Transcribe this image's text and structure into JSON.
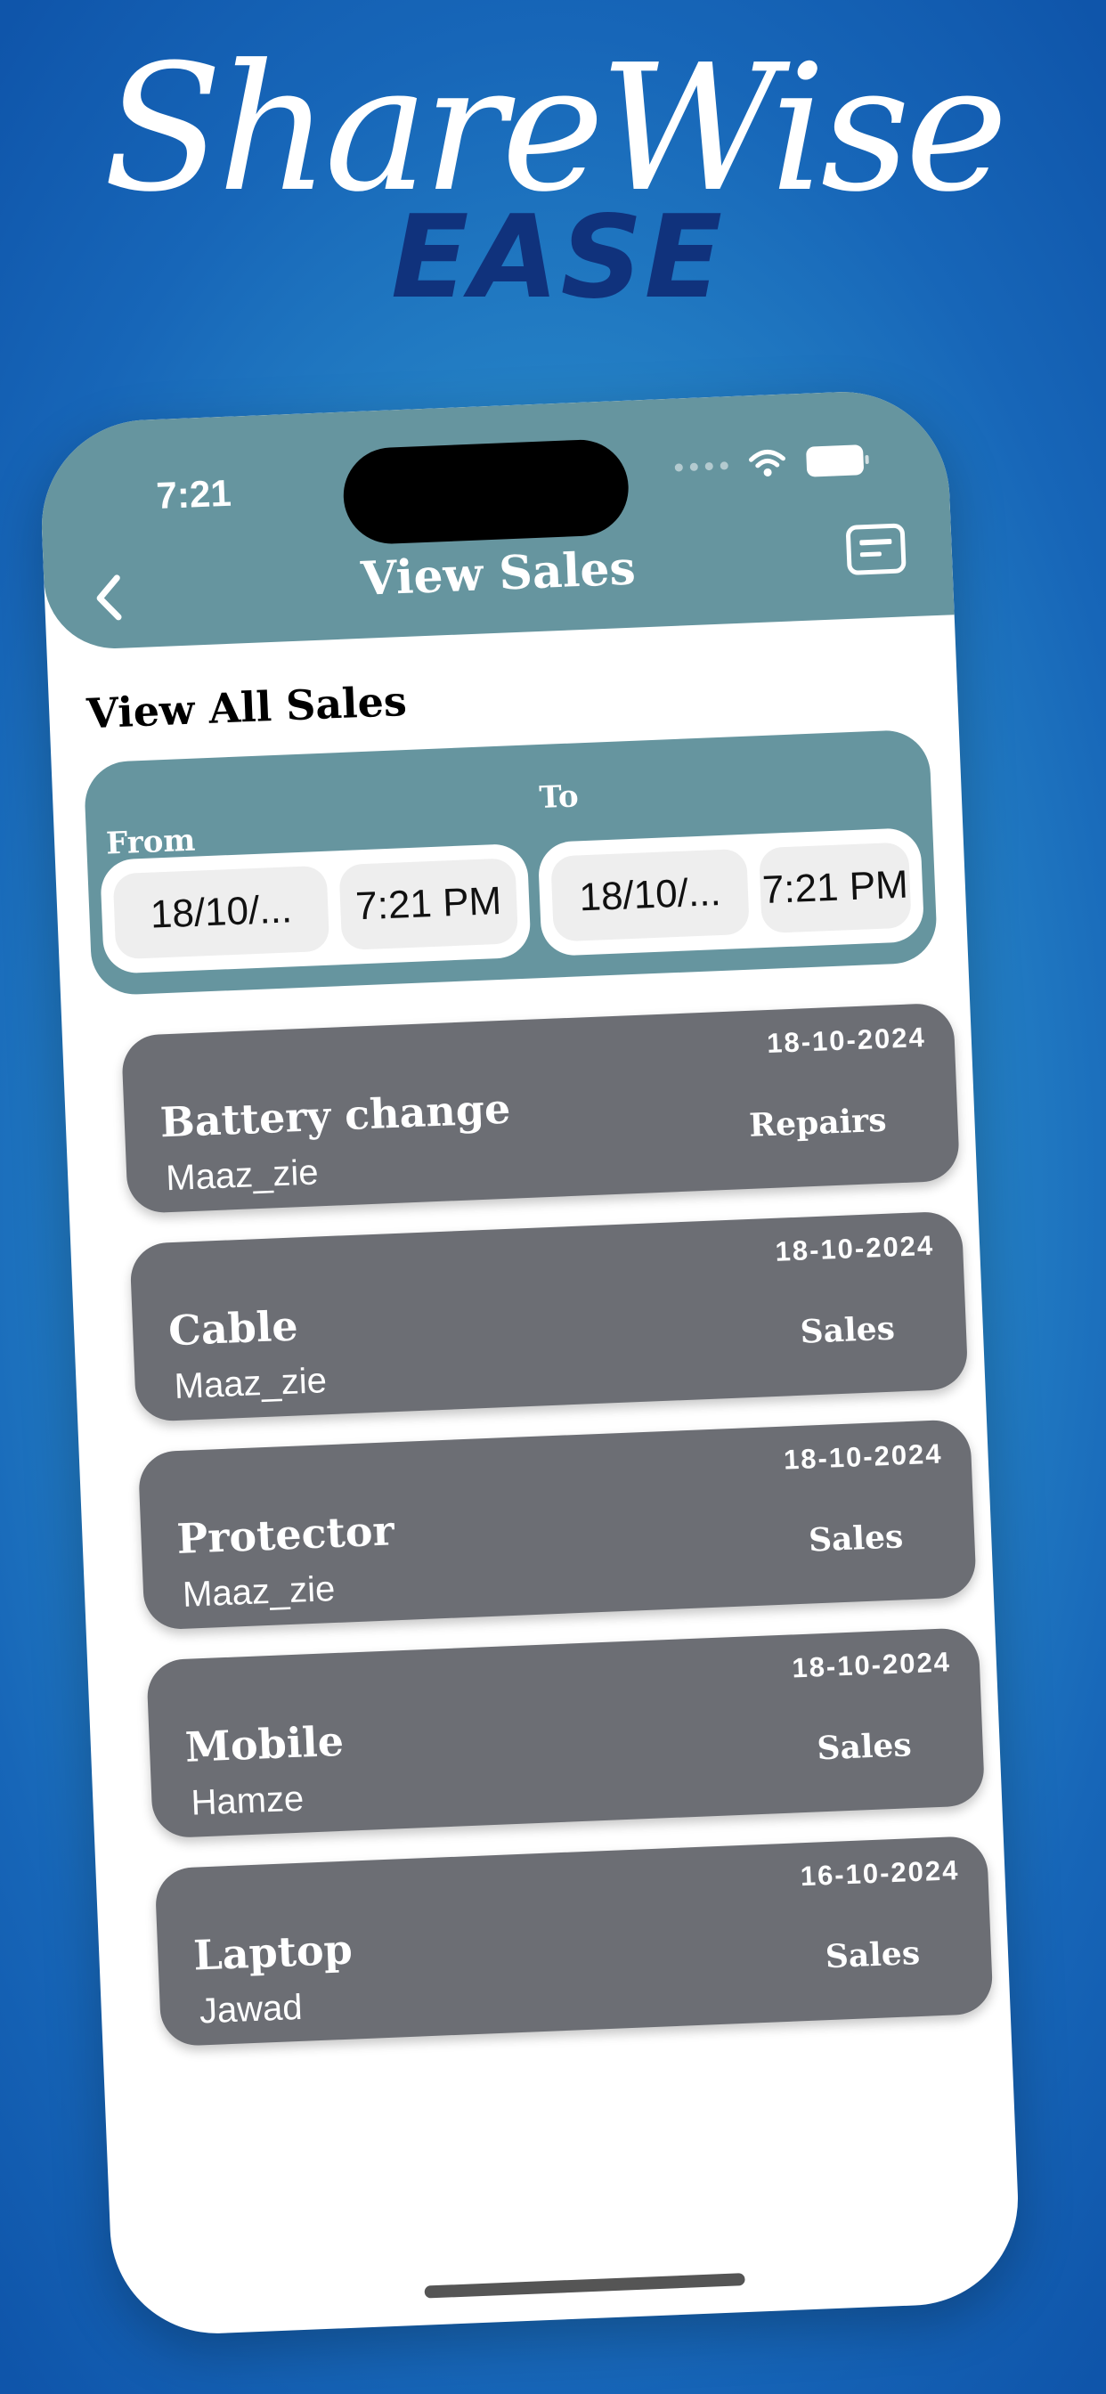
{
  "brand": {
    "title": "ShareWise",
    "subtitle": "EASE"
  },
  "status_bar": {
    "time": "7:21"
  },
  "nav": {
    "title": "View Sales",
    "back_icon": "chevron-left-icon",
    "menu_icon": "card-icon"
  },
  "page": {
    "section_title": "View All Sales"
  },
  "filter": {
    "from_label": "From",
    "to_label": "To",
    "from_date": "18/10/...",
    "from_time": "7:21 PM",
    "to_date": "18/10/...",
    "to_time": "7:21 PM"
  },
  "sales": [
    {
      "date": "18-10-2024",
      "title": "Battery change",
      "user": "Maaz_zie",
      "category": "Repairs"
    },
    {
      "date": "18-10-2024",
      "title": "Cable",
      "user": "Maaz_zie",
      "category": "Sales"
    },
    {
      "date": "18-10-2024",
      "title": "Protector",
      "user": "Maaz_zie",
      "category": "Sales"
    },
    {
      "date": "18-10-2024",
      "title": "Mobile",
      "user": "Hamze",
      "category": "Sales"
    },
    {
      "date": "16-10-2024",
      "title": "Laptop",
      "user": "Jawad",
      "category": "Sales"
    }
  ],
  "colors": {
    "header": "#66959f",
    "card": "#6c6e74",
    "brand_sub": "#10327c"
  }
}
